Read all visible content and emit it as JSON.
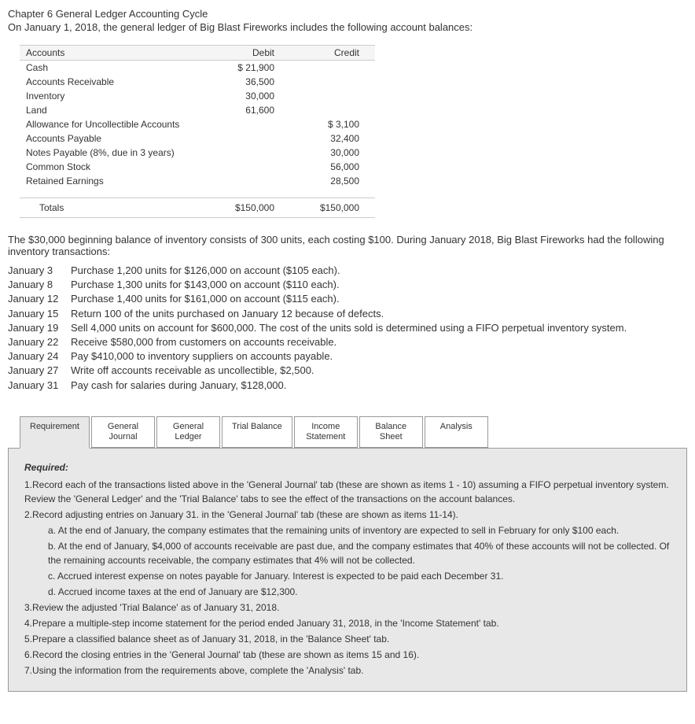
{
  "title": "Chapter 6 General Ledger Accounting Cycle",
  "subtitle": "On January 1, 2018, the general ledger of Big Blast Fireworks includes the following account balances:",
  "ledger": {
    "headers": {
      "accounts": "Accounts",
      "debit": "Debit",
      "credit": "Credit"
    },
    "rows": [
      {
        "name": "Cash",
        "debit": "$ 21,900",
        "credit": ""
      },
      {
        "name": "Accounts Receivable",
        "debit": "36,500",
        "credit": ""
      },
      {
        "name": "Inventory",
        "debit": "30,000",
        "credit": ""
      },
      {
        "name": "Land",
        "debit": "61,600",
        "credit": ""
      },
      {
        "name": "Allowance for Uncollectible Accounts",
        "debit": "",
        "credit": "$  3,100"
      },
      {
        "name": "Accounts Payable",
        "debit": "",
        "credit": "32,400"
      },
      {
        "name": "Notes Payable (8%, due in 3 years)",
        "debit": "",
        "credit": "30,000"
      },
      {
        "name": "Common Stock",
        "debit": "",
        "credit": "56,000"
      },
      {
        "name": "Retained Earnings",
        "debit": "",
        "credit": "28,500"
      }
    ],
    "totals": {
      "label": "Totals",
      "debit": "$150,000",
      "credit": "$150,000"
    }
  },
  "inventory_intro": "The $30,000 beginning balance of inventory consists of 300 units, each costing $100. During January 2018, Big Blast Fireworks had the following inventory transactions:",
  "transactions": [
    {
      "date": "January 3",
      "desc": "Purchase 1,200 units for $126,000 on account ($105 each)."
    },
    {
      "date": "January 8",
      "desc": "Purchase 1,300 units for $143,000 on account ($110 each)."
    },
    {
      "date": "January 12",
      "desc": "Purchase 1,400 units for $161,000 on account ($115 each)."
    },
    {
      "date": "January 15",
      "desc": "Return 100 of the units purchased on January 12 because of defects."
    },
    {
      "date": "January 19",
      "desc": "Sell 4,000 units on account for $600,000. The cost of the units sold is determined using a FIFO perpetual inventory system."
    },
    {
      "date": "January 22",
      "desc": "Receive $580,000 from customers on accounts receivable."
    },
    {
      "date": "January 24",
      "desc": "Pay $410,000 to inventory suppliers on accounts payable."
    },
    {
      "date": "January 27",
      "desc": "Write off accounts receivable as uncollectible, $2,500."
    },
    {
      "date": "January 31",
      "desc": "Pay cash for salaries during January, $128,000."
    }
  ],
  "tabs": [
    {
      "label": "Requirement"
    },
    {
      "label": "General\nJournal"
    },
    {
      "label": "General\nLedger"
    },
    {
      "label": "Trial Balance"
    },
    {
      "label": "Income\nStatement"
    },
    {
      "label": "Balance\nSheet"
    },
    {
      "label": "Analysis"
    }
  ],
  "requirements": {
    "heading": "Required:",
    "items": [
      {
        "num": "1.",
        "text": "Record each of the transactions listed above in the 'General Journal' tab (these are shown as items 1 - 10) assuming a FIFO perpetual inventory system. Review the 'General Ledger' and the 'Trial Balance' tabs to see the effect of the transactions on the account balances."
      },
      {
        "num": "2.",
        "text": "Record adjusting entries on January 31. in the 'General Journal' tab (these are shown as items 11-14).",
        "sub": [
          {
            "letter": "a.",
            "text": "At the end of January, the company estimates that the remaining units of inventory are expected to sell in February for only $100 each."
          },
          {
            "letter": "b.",
            "text": "At the end of January, $4,000 of accounts receivable are past due, and the company estimates that 40% of these accounts will not be collected. Of the remaining accounts receivable, the company estimates that 4% will not be collected."
          },
          {
            "letter": "c.",
            "text": "Accrued interest expense on notes payable for January. Interest is expected to be paid each December 31."
          },
          {
            "letter": "d.",
            "text": "Accrued income taxes at the end of January are $12,300."
          }
        ]
      },
      {
        "num": "3.",
        "text": "Review the adjusted 'Trial Balance' as of January 31, 2018."
      },
      {
        "num": "4.",
        "text": "Prepare a multiple-step income statement for the period ended January 31, 2018, in the 'Income Statement' tab."
      },
      {
        "num": "5.",
        "text": "Prepare a classified balance sheet as of January 31, 2018, in the 'Balance Sheet' tab."
      },
      {
        "num": "6.",
        "text": "Record the closing entries in the 'General Journal' tab (these are shown as items 15 and 16)."
      },
      {
        "num": "7.",
        "text": "Using the information from the requirements above, complete the 'Analysis' tab."
      }
    ]
  }
}
